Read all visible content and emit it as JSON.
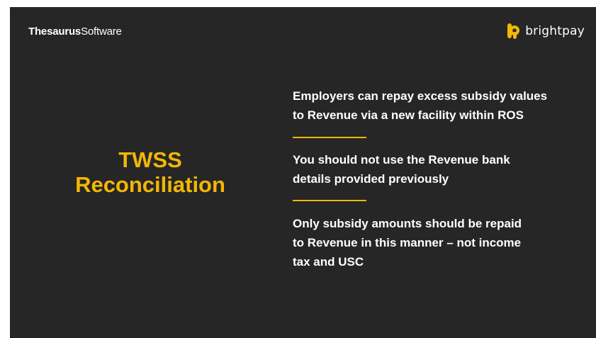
{
  "header": {
    "left_brand_bold": "Thesaurus",
    "left_brand_light": "Software",
    "right_brand_text": "brightpay",
    "right_brand_icon": "brightpay-logo-icon"
  },
  "title": {
    "line1": "TWSS",
    "line2": "Reconciliation"
  },
  "points": [
    "Employers can repay excess subsidy values to Revenue via a new facility within ROS",
    "You should not use the Revenue bank details provided previously",
    "Only subsidy amounts should be repaid to Revenue in this manner – not income tax and USC"
  ],
  "colors": {
    "background": "#262626",
    "accent": "#f2b705",
    "text": "#ffffff"
  }
}
